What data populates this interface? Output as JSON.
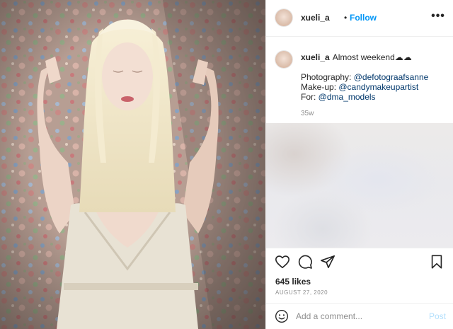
{
  "header": {
    "username": "xueli_a",
    "separator": "•",
    "follow_label": "Follow",
    "more_label": "•••"
  },
  "caption": {
    "username": "xueli_a",
    "text": "Almost weekend☁☁",
    "lines": [
      {
        "prefix": "Photography: ",
        "mention": "@defotograafsanne"
      },
      {
        "prefix": "Make-up: ",
        "mention": "@candymakeupartist"
      },
      {
        "prefix": "For: ",
        "mention": "@dma_models"
      }
    ],
    "time_ago": "35w"
  },
  "stats": {
    "likes": "645 likes",
    "date": "AUGUST 27, 2020"
  },
  "comment": {
    "placeholder": "Add a comment...",
    "post_label": "Post"
  },
  "icons": {
    "like": "heart-icon",
    "comment": "comment-icon",
    "share": "share-icon",
    "save": "bookmark-icon",
    "emoji": "emoji-icon",
    "more": "more-options-icon"
  },
  "colors": {
    "link": "#0095f6",
    "mention": "#00376b",
    "muted": "#8e8e8e",
    "post_disabled": "#b2dffc"
  }
}
